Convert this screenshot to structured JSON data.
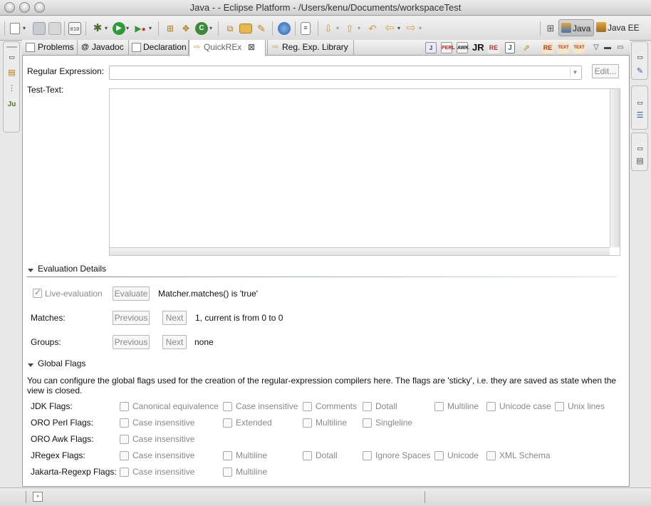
{
  "window": {
    "title": "Java -  - Eclipse Platform - /Users/kenu/Documents/workspaceTest"
  },
  "toolbar": {
    "icons": [
      "new-wizard-icon",
      "save-icon",
      "print-icon",
      "binary-icon",
      "debug-icon",
      "run-icon",
      "external-tools-icon",
      "new-java-project-icon",
      "new-package-icon",
      "new-class-icon",
      "open-type-icon",
      "open-folder-icon",
      "open-task-icon",
      "web-browser-icon",
      "annotations-icon",
      "next-annotation-icon",
      "previous-annotation-icon",
      "last-edit-icon",
      "back-icon",
      "forward-icon"
    ]
  },
  "perspectives": {
    "java_label": "Java",
    "javaee_label": "Java EE"
  },
  "tabs": [
    {
      "label": "Problems",
      "icon": "problems-icon"
    },
    {
      "label": "Javadoc",
      "icon": "javadoc-icon"
    },
    {
      "label": "Declaration",
      "icon": "declaration-icon"
    },
    {
      "label": "QuickREx",
      "icon": "quickrex-icon"
    },
    {
      "label": "Reg. Exp. Library",
      "icon": "regexp-library-icon"
    }
  ],
  "view_toolbar": {
    "perl_label": "PERL",
    "awk_label": "AWK",
    "jr_label": "JR",
    "re_label": "RE",
    "text_label": "TEXT"
  },
  "regex": {
    "label": "Regular Expression:",
    "value": "",
    "edit_label": "Edit..."
  },
  "testtext": {
    "label": "Test-Text:",
    "value": ""
  },
  "evaluation": {
    "title": "Evaluation Details",
    "live_label": "Live-evaluation",
    "live_checked": true,
    "evaluate_label": "Evaluate",
    "result": "Matcher.matches() is 'true'",
    "matches_label": "Matches:",
    "previous_label": "Previous",
    "next_label": "Next",
    "matches_info": "1, current is from 0 to 0",
    "groups_label": "Groups:",
    "groups_info": "none"
  },
  "global_flags": {
    "title": "Global Flags",
    "description": "You can configure the global flags used for the creation of the regular-expression compilers here. The flags are 'sticky', i.e. they are saved as state when the view is closed.",
    "rows": [
      {
        "label": "JDK Flags:",
        "flags": [
          "Canonical equivalence",
          "Case insensitive",
          "Comments",
          "Dotall",
          "Multiline",
          "Unicode case",
          "Unix lines"
        ]
      },
      {
        "label": "ORO Perl Flags:",
        "flags": [
          "Case insensitive",
          "Extended",
          "Multiline",
          "Singleline"
        ]
      },
      {
        "label": "ORO Awk Flags:",
        "flags": [
          "Case insensitive"
        ]
      },
      {
        "label": "JRegex Flags:",
        "flags": [
          "Case insensitive",
          "Multiline",
          "Dotall",
          "Ignore Spaces",
          "Unicode",
          "XML Schema"
        ]
      },
      {
        "label": "Jakarta-Regexp Flags:",
        "flags": [
          "Case insensitive",
          "Multiline"
        ]
      }
    ]
  },
  "colors": {
    "accent": "#6e86a8",
    "disabled_text": "#888888"
  }
}
